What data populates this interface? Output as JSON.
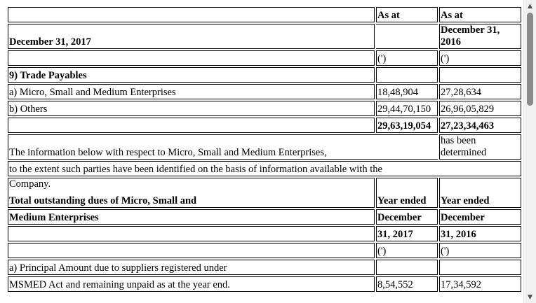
{
  "header": {
    "as_at_1": "As at",
    "as_at_2": "As at",
    "date_2017": "December 31, 2017",
    "date_2016_line1": "December 31,",
    "date_2016_line2": "2016",
    "currency_1": "(')",
    "currency_2": "(')"
  },
  "trade_payables": {
    "title": "9) Trade Payables",
    "rows": [
      {
        "label": "a) Micro, Small and Medium Enterprises",
        "v2017": "18,48,904",
        "v2016": "27,28,634"
      },
      {
        "label": "b) Others",
        "v2017": "29,44,70,150",
        "v2016": "26,96,05,829"
      }
    ],
    "total_2017": "29,63,19,054",
    "total_2016": "27,23,34,463"
  },
  "msme_note": {
    "line1": "The information below with respect to Micro, Small and Medium Enterprises,",
    "line1_right_a": "has been",
    "line1_right_b": "determined",
    "line2": "to the extent such parties have been identified on the basis of information available with the",
    "line3": "Company."
  },
  "dues": {
    "heading_1": "Total outstanding dues of Micro, Small and",
    "heading_2": "Medium Enterprises",
    "year_ended_1": "Year ended",
    "year_ended_2": "Year ended",
    "december_1": "December",
    "december_2": "December",
    "year_2017": "31, 2017",
    "year_2016": "31, 2016",
    "currency_1": "(')",
    "currency_2": "(')",
    "row_a_line1": "a) Principal Amount due to suppliers registered under",
    "row_a_line2": "MSMED Act and remaining unpaid as at the year end.",
    "row_a_2017": "8,54,552",
    "row_a_2016": "17,34,592"
  },
  "scrollbar": {
    "up_glyph": "▲",
    "down_glyph": "▼",
    "thumb_position": 0.0
  }
}
